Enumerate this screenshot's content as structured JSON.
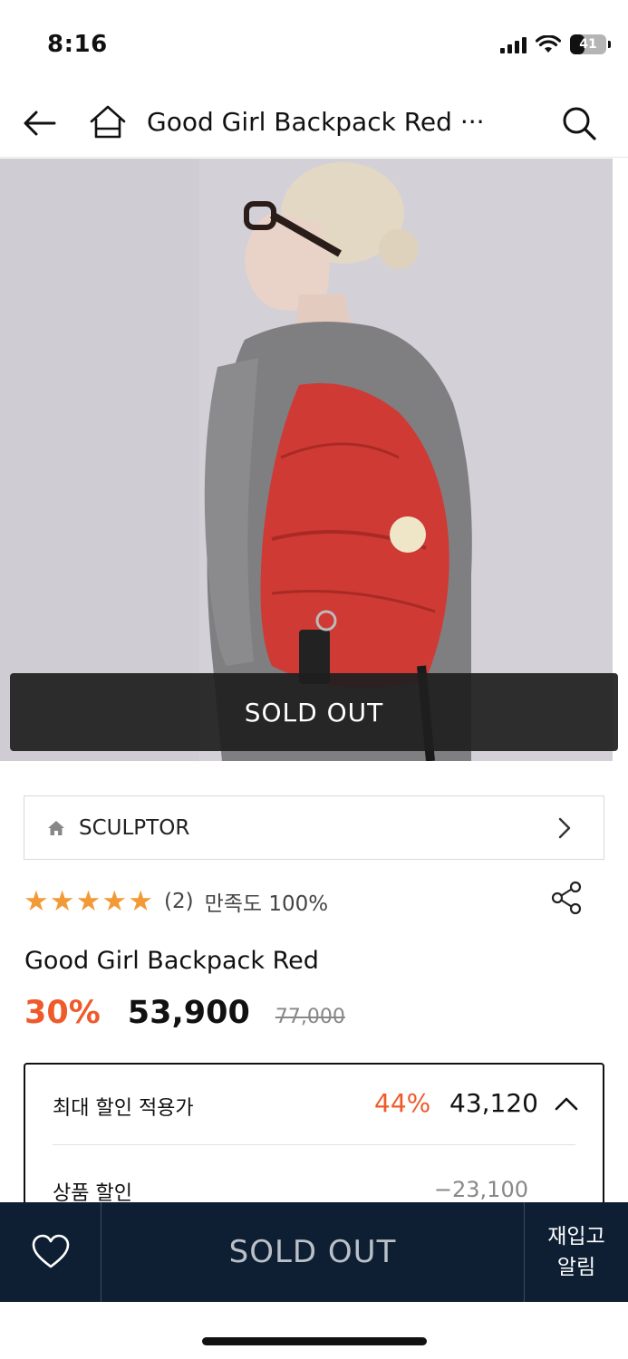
{
  "status_bar": {
    "time": "8:16",
    "battery": "41",
    "battery_level": 0.41
  },
  "header": {
    "title": "Good Girl Backpack Red ···"
  },
  "hero": {
    "overlay_label": "SOLD OUT"
  },
  "brand": {
    "name": "SCULPTOR"
  },
  "rating": {
    "stars": 5,
    "review_count": "(2)",
    "satisfaction": "만족도 100%"
  },
  "product": {
    "name": "Good Girl Backpack Red",
    "discount_rate": "30%",
    "sale_price": "53,900",
    "original_price": "77,000"
  },
  "max_discount": {
    "label": "최대 할인 적용가",
    "rate": "44%",
    "price": "43,120",
    "sub_label": "상품 할인",
    "sub_value": "−23,100"
  },
  "bottom_bar": {
    "buy_label": "SOLD OUT",
    "restock_line1": "재입고",
    "restock_line2": "알림"
  },
  "colors": {
    "accent": "#ef5a2b",
    "star": "#f29a38",
    "bottom_bar": "#0f1f33"
  }
}
